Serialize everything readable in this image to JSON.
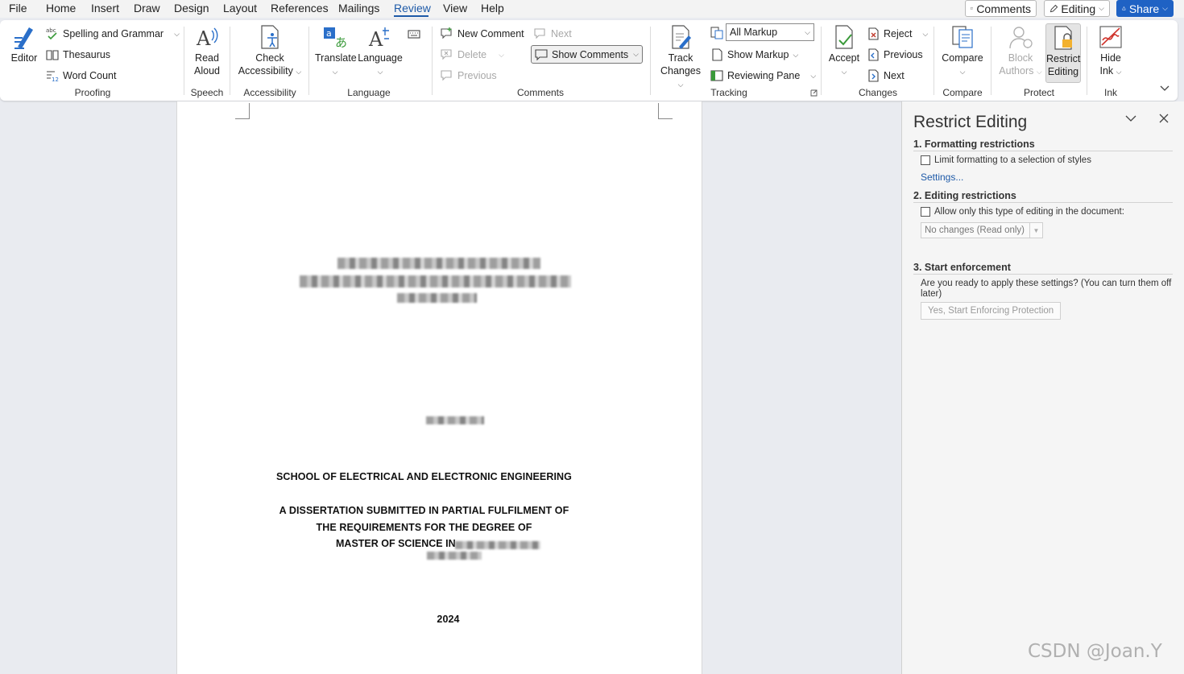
{
  "menu": {
    "items": [
      "File",
      "Home",
      "Insert",
      "Draw",
      "Design",
      "Layout",
      "References",
      "Mailings",
      "Review",
      "View",
      "Help"
    ],
    "active": "Review",
    "comments_btn": "Comments",
    "editing_btn": "Editing",
    "share_btn": "Share"
  },
  "ribbon": {
    "proofing": {
      "label": "Proofing",
      "editor": "Editor",
      "spelling": "Spelling and Grammar",
      "thesaurus": "Thesaurus",
      "word_count": "Word Count"
    },
    "speech": {
      "label": "Speech",
      "read_aloud_1": "Read",
      "read_aloud_2": "Aloud"
    },
    "accessibility": {
      "label": "Accessibility",
      "check_1": "Check",
      "check_2": "Accessibility"
    },
    "language": {
      "label": "Language",
      "translate": "Translate",
      "language": "Language"
    },
    "comments": {
      "label": "Comments",
      "new": "New Comment",
      "next": "Next",
      "delete": "Delete",
      "show": "Show Comments",
      "previous": "Previous"
    },
    "tracking": {
      "label": "Tracking",
      "track_1": "Track",
      "track_2": "Changes",
      "markup_select": "All Markup",
      "show_markup": "Show Markup",
      "reviewing_pane": "Reviewing Pane"
    },
    "changes": {
      "label": "Changes",
      "accept": "Accept",
      "reject": "Reject",
      "previous": "Previous",
      "next": "Next"
    },
    "compare": {
      "label": "Compare",
      "compare": "Compare"
    },
    "protect": {
      "label": "Protect",
      "block_1": "Block",
      "block_2": "Authors",
      "restrict_1": "Restrict",
      "restrict_2": "Editing"
    },
    "ink": {
      "label": "Ink",
      "hide_1": "Hide",
      "hide_2": "Ink"
    }
  },
  "document": {
    "school": "SCHOOL OF ELECTRICAL AND ELECTRONIC ENGINEERING",
    "line1": "A DISSERTATION SUBMITTED IN PARTIAL FULFILMENT OF",
    "line2": "THE REQUIREMENTS FOR THE DEGREE OF",
    "line3": "MASTER OF SCIENCE IN",
    "year": "2024"
  },
  "pane": {
    "title": "Restrict Editing",
    "sec1": "1. Formatting restrictions",
    "sec1_check": "Limit formatting to a selection of styles",
    "sec1_link": "Settings...",
    "sec2": "2. Editing restrictions",
    "sec2_check": "Allow only this type of editing in the document:",
    "sec2_select": "No changes (Read only)",
    "sec3": "3. Start enforcement",
    "sec3_text": "Are you ready to apply these settings? (You can turn them off later)",
    "sec3_button": "Yes, Start Enforcing Protection"
  },
  "watermark": "CSDN @Joan.Y",
  "colors": {
    "accent": "#1e5aa8",
    "share": "#1f62c4",
    "pane_bg": "#f5f5f5",
    "canvas": "#e9ebf0"
  }
}
